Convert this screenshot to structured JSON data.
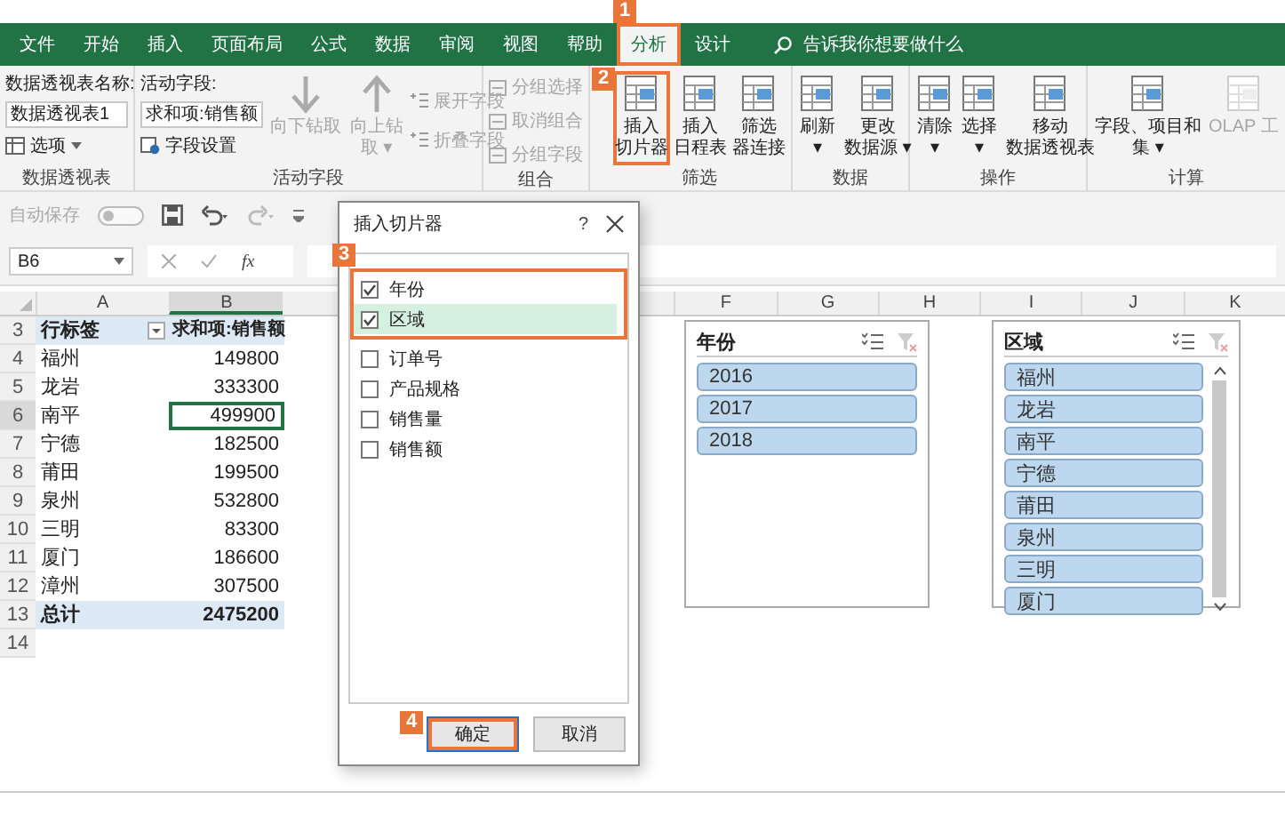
{
  "tabs": [
    {
      "label": "文件",
      "selected": false,
      "highlighted": false
    },
    {
      "label": "开始",
      "selected": false,
      "highlighted": false
    },
    {
      "label": "插入",
      "selected": false,
      "highlighted": false
    },
    {
      "label": "页面布局",
      "selected": false,
      "highlighted": false
    },
    {
      "label": "公式",
      "selected": false,
      "highlighted": false
    },
    {
      "label": "数据",
      "selected": false,
      "highlighted": false
    },
    {
      "label": "审阅",
      "selected": false,
      "highlighted": false
    },
    {
      "label": "视图",
      "selected": false,
      "highlighted": false
    },
    {
      "label": "帮助",
      "selected": false,
      "highlighted": false
    },
    {
      "label": "分析",
      "selected": true,
      "highlighted": true
    },
    {
      "label": "设计",
      "selected": false,
      "highlighted": false
    }
  ],
  "tell_me": {
    "placeholder": "告诉我你想要做什么"
  },
  "ribbon": {
    "pivot_table": {
      "name_label": "数据透视表名称:",
      "name_value": "数据透视表1",
      "options_button": "选项",
      "group_label": "数据透视表"
    },
    "active_field": {
      "field_label": "活动字段:",
      "field_value": "求和项:销售额",
      "settings_button": "字段设置",
      "group_label": "活动字段",
      "large_buttons": [
        {
          "lines": [
            "向下钻取"
          ],
          "disabled": true
        },
        {
          "lines": [
            "向上钻",
            "取 ▾"
          ],
          "disabled": true
        }
      ],
      "small_buttons": [
        {
          "label": "展开字段",
          "disabled": true
        },
        {
          "label": "折叠字段",
          "disabled": true
        }
      ]
    },
    "groups": [
      {
        "label": "组合",
        "kind": "small",
        "buttons": [
          {
            "lines": [
              "分组选择"
            ],
            "disabled": true,
            "highlighted": false
          },
          {
            "lines": [
              "取消组合"
            ],
            "disabled": true,
            "highlighted": false
          },
          {
            "lines": [
              "分组字段"
            ],
            "disabled": true,
            "highlighted": false
          }
        ]
      },
      {
        "label": "筛选",
        "kind": "large",
        "buttons": [
          {
            "lines": [
              "插入",
              "切片器"
            ],
            "disabled": false,
            "highlighted": true
          },
          {
            "lines": [
              "插入",
              "日程表"
            ],
            "disabled": false,
            "highlighted": false
          },
          {
            "lines": [
              "筛选",
              "器连接"
            ],
            "disabled": false,
            "highlighted": false
          }
        ]
      },
      {
        "label": "数据",
        "kind": "large",
        "buttons": [
          {
            "lines": [
              "刷新",
              "▾"
            ],
            "disabled": false,
            "highlighted": false
          },
          {
            "lines": [
              "更改",
              "数据源 ▾"
            ],
            "disabled": false,
            "highlighted": false
          }
        ]
      },
      {
        "label": "操作",
        "kind": "large",
        "buttons": [
          {
            "lines": [
              "清除",
              "▾"
            ],
            "disabled": false,
            "highlighted": false
          },
          {
            "lines": [
              "选择",
              "▾"
            ],
            "disabled": false,
            "highlighted": false
          },
          {
            "lines": [
              "移动",
              "数据透视表"
            ],
            "disabled": false,
            "highlighted": false
          }
        ]
      },
      {
        "label": "计算",
        "kind": "large",
        "buttons": [
          {
            "lines": [
              "字段、项目和",
              "集 ▾"
            ],
            "disabled": false,
            "highlighted": false
          },
          {
            "lines": [
              "OLAP 工"
            ],
            "disabled": true,
            "highlighted": false
          }
        ]
      }
    ]
  },
  "quick_access": {
    "autosave_label": "自动保存"
  },
  "formula_bar": {
    "name_box": "B6",
    "function_label": "fx"
  },
  "sheet": {
    "columns": [
      "A",
      "B",
      "F",
      "G",
      "H",
      "I",
      "J",
      "K"
    ],
    "header": {
      "row_number": "3",
      "row_label": "行标签",
      "value_label": "求和项:销售额"
    },
    "rows": [
      {
        "row_number": "4",
        "name": "福州",
        "value": "149800",
        "selected": false
      },
      {
        "row_number": "5",
        "name": "龙岩",
        "value": "333300",
        "selected": false
      },
      {
        "row_number": "6",
        "name": "南平",
        "value": "499900",
        "selected": true
      },
      {
        "row_number": "7",
        "name": "宁德",
        "value": "182500",
        "selected": false
      },
      {
        "row_number": "8",
        "name": "莆田",
        "value": "199500",
        "selected": false
      },
      {
        "row_number": "9",
        "name": "泉州",
        "value": "532800",
        "selected": false
      },
      {
        "row_number": "10",
        "name": "三明",
        "value": "83300",
        "selected": false
      },
      {
        "row_number": "11",
        "name": "厦门",
        "value": "186600",
        "selected": false
      },
      {
        "row_number": "12",
        "name": "漳州",
        "value": "307500",
        "selected": false
      }
    ],
    "total": {
      "row_number": "13",
      "name": "总计",
      "value": "2475200"
    },
    "empty_rows": [
      "14"
    ]
  },
  "dialog": {
    "title": "插入切片器",
    "help": "?",
    "fields": [
      {
        "label": "年份",
        "checked": true,
        "selected": false,
        "highlighted": true
      },
      {
        "label": "区域",
        "checked": true,
        "selected": true,
        "highlighted": true
      },
      {
        "label": "订单号",
        "checked": false,
        "selected": false,
        "highlighted": false
      },
      {
        "label": "产品规格",
        "checked": false,
        "selected": false,
        "highlighted": false
      },
      {
        "label": "销售量",
        "checked": false,
        "selected": false,
        "highlighted": false
      },
      {
        "label": "销售额",
        "checked": false,
        "selected": false,
        "highlighted": false
      }
    ],
    "ok_button": "确定",
    "ok_highlighted": true,
    "cancel_button": "取消"
  },
  "slicers": [
    {
      "title": "年份",
      "scrollable": false,
      "items": [
        {
          "label": "2016",
          "selected": true
        },
        {
          "label": "2017",
          "selected": true
        },
        {
          "label": "2018",
          "selected": true
        }
      ]
    },
    {
      "title": "区域",
      "scrollable": true,
      "items": [
        {
          "label": "福州",
          "selected": true
        },
        {
          "label": "龙岩",
          "selected": true
        },
        {
          "label": "南平",
          "selected": true
        },
        {
          "label": "宁德",
          "selected": true
        },
        {
          "label": "莆田",
          "selected": true
        },
        {
          "label": "泉州",
          "selected": true
        },
        {
          "label": "三明",
          "selected": true
        },
        {
          "label": "厦门",
          "selected": true
        }
      ]
    }
  ],
  "callouts": [
    {
      "number": "1"
    },
    {
      "number": "2"
    },
    {
      "number": "3"
    },
    {
      "number": "4"
    }
  ]
}
